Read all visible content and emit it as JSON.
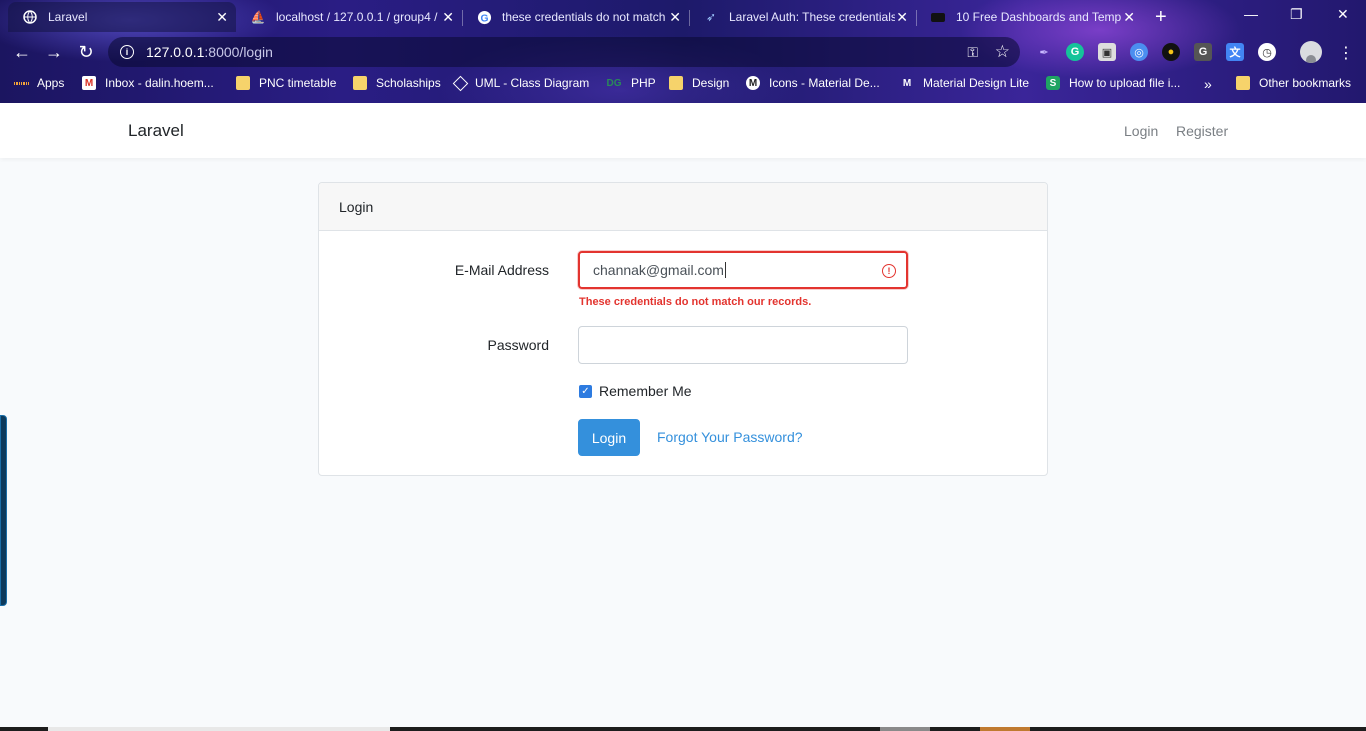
{
  "tabs": [
    {
      "label": "Laravel",
      "icon": "globe-icon"
    },
    {
      "label": "localhost / 127.0.0.1 / group4 / ",
      "icon": "phpmyadmin-icon"
    },
    {
      "label": "these credentials do not match",
      "icon": "google-icon"
    },
    {
      "label": "Laravel Auth: These credentials",
      "icon": "arrow-icon"
    },
    {
      "label": "10 Free Dashboards and Temp",
      "icon": "dashboard-icon"
    }
  ],
  "address": {
    "host": "127.0.0.1",
    "path": ":8000/login"
  },
  "bookmarks": [
    {
      "label": "Apps"
    },
    {
      "label": "Inbox - dalin.hoem..."
    },
    {
      "label": "PNC timetable"
    },
    {
      "label": "Scholaships"
    },
    {
      "label": "UML - Class Diagram"
    },
    {
      "label": "PHP"
    },
    {
      "label": "Design"
    },
    {
      "label": "Icons - Material De..."
    },
    {
      "label": "Material Design Lite"
    },
    {
      "label": "How to upload file i..."
    },
    {
      "label": "Other bookmarks"
    }
  ],
  "app": {
    "brand": "Laravel",
    "nav": {
      "login": "Login",
      "register": "Register"
    }
  },
  "login_card": {
    "header": "Login",
    "email_label": "E-Mail Address",
    "email_value": "channak@gmail.com",
    "error": "These credentials do not match our records.",
    "password_label": "Password",
    "password_value": "",
    "remember_label": "Remember Me",
    "remember_checked": true,
    "submit_label": "Login",
    "forgot_label": "Forgot Your Password?"
  },
  "colors": {
    "primary": "#3490dc",
    "error": "#e3342f",
    "background": "#f8fafc"
  }
}
